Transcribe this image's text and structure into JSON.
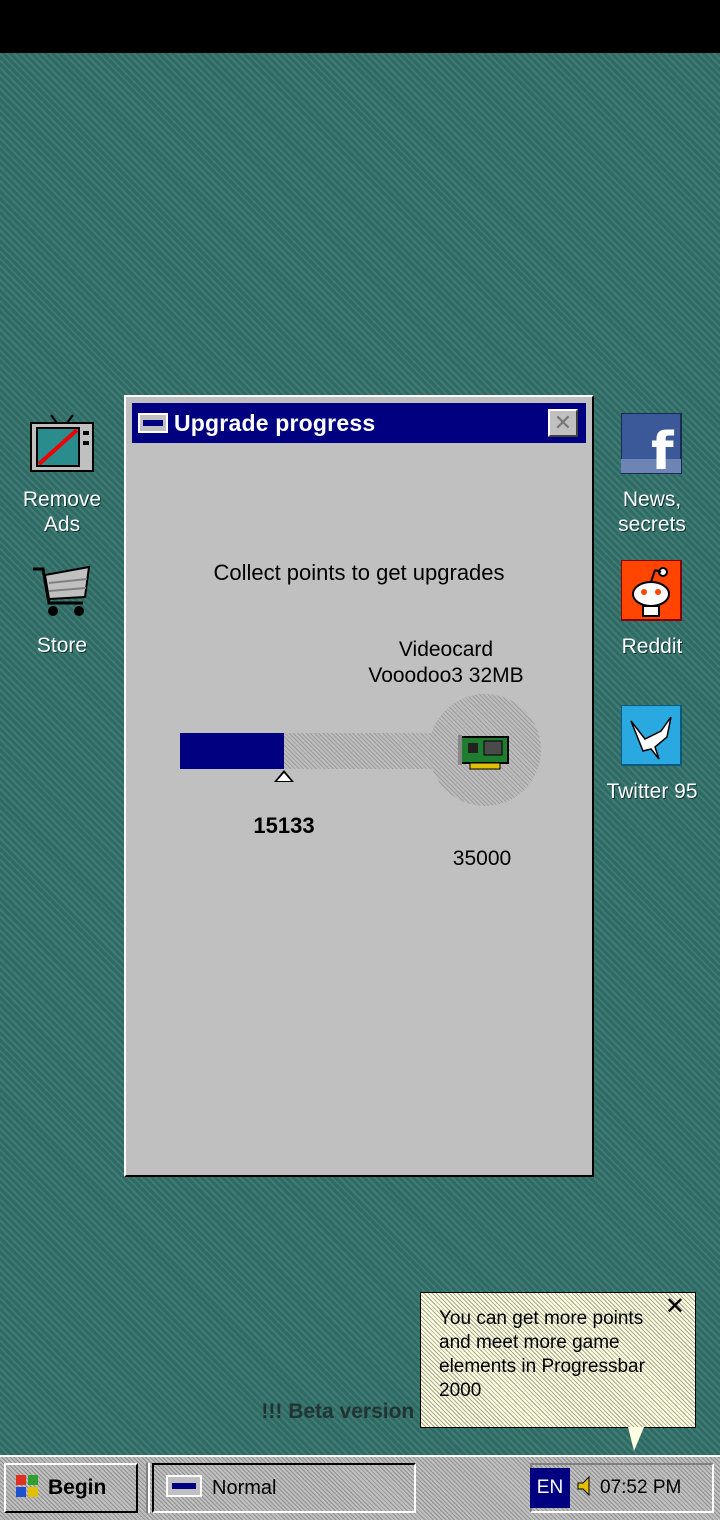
{
  "desktop": {
    "icons_left": [
      {
        "label": "Remove\nAds",
        "icon": "tv-no-ads-icon"
      },
      {
        "label": "Store",
        "icon": "shopping-cart-icon"
      }
    ],
    "icons_right": [
      {
        "label": "News,\nsecrets",
        "icon": "facebook-icon"
      },
      {
        "label": "Reddit",
        "icon": "reddit-icon"
      },
      {
        "label": "Twitter 95",
        "icon": "twitter-icon"
      }
    ],
    "beta_text": "!!! Beta version 2 !!!"
  },
  "window": {
    "title": "Upgrade progress",
    "instruction": "Collect points to get upgrades",
    "target_line1": "Videocard",
    "target_line2": "Vooodoo3 32MB",
    "current_points": "15133",
    "goal_points": "35000",
    "progress_fraction": 0.4324
  },
  "tooltip": {
    "text": "You can get more points and meet more game elements in Progressbar 2000"
  },
  "taskbar": {
    "start_label": "Begin",
    "task_label": "Normal",
    "language": "EN",
    "clock": "07:52 PM"
  },
  "colors": {
    "desktop": "#2d6b64",
    "titlebar": "#000080",
    "window": "#c0c0c0",
    "progress_fill": "#000080"
  }
}
